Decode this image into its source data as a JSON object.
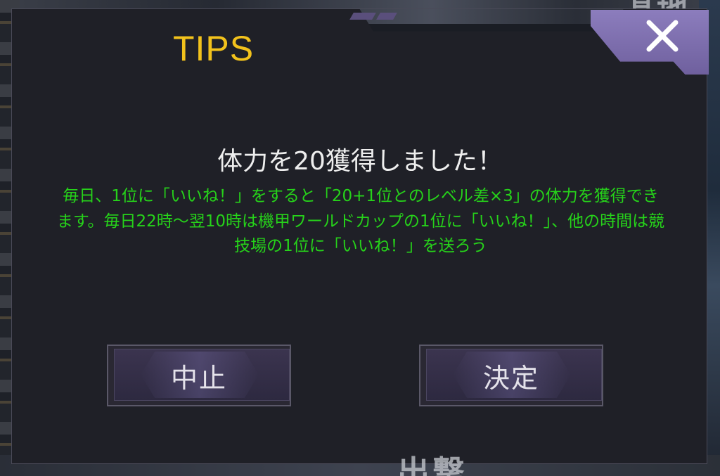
{
  "dialog": {
    "title": "TIPS",
    "heading": "体力を20獲得しました！",
    "description": "毎日、1位に「いいね！」をすると「20+1位とのレベル差×3」の体力を獲得できます。毎日22時～翌10時は機甲ワールドカップの1位に「いいね！」、他の時間は競技場の1位に「いいね！」を送ろう",
    "close_icon": "close-icon"
  },
  "buttons": {
    "cancel_label": "中止",
    "confirm_label": "決定"
  },
  "background": {
    "bottom_text": "出撃",
    "top_text": "基地"
  },
  "colors": {
    "title": "#f2c21c",
    "description": "#26d21a",
    "heading": "#eeeeee",
    "accent": "#7b6bab"
  }
}
